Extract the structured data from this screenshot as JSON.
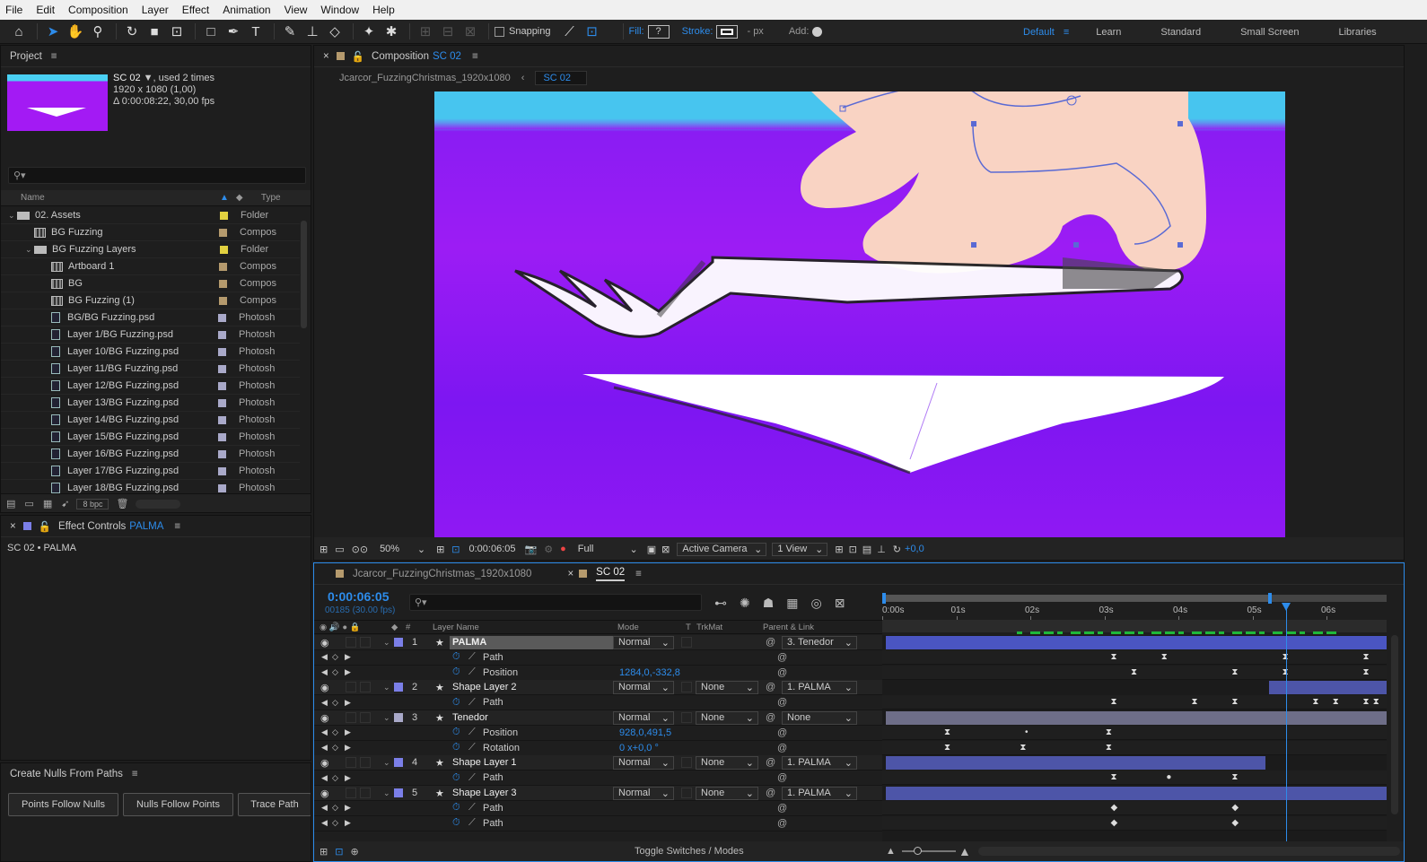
{
  "menu": [
    "File",
    "Edit",
    "Composition",
    "Layer",
    "Effect",
    "Animation",
    "View",
    "Window",
    "Help"
  ],
  "toolbar": {
    "snapping": "Snapping",
    "fill_label": "Fill:",
    "fill_value": "?",
    "stroke_label": "Stroke:",
    "stroke_unit": "- px",
    "add_label": "Add:",
    "workspaces": [
      "Default",
      "Learn",
      "Standard",
      "Small Screen",
      "Libraries"
    ]
  },
  "project": {
    "title": "Project",
    "comp_name": "SC 02",
    "used": ", used 2 times",
    "dims": "1920 x 1080 (1,00)",
    "duration": "Δ 0:00:08:22, 30,00 fps",
    "col_name": "Name",
    "col_type": "Type",
    "items": [
      {
        "name": "02. Assets",
        "type": "Folder",
        "indent": 0,
        "kind": "folder",
        "color": "#e2d140",
        "twirl": "open"
      },
      {
        "name": "BG Fuzzing",
        "type": "Compos",
        "indent": 1,
        "kind": "comp",
        "color": "#b59a6d",
        "twirl": ""
      },
      {
        "name": "BG Fuzzing Layers",
        "type": "Folder",
        "indent": 1,
        "kind": "folder",
        "color": "#e2d140",
        "twirl": "open"
      },
      {
        "name": "Artboard 1",
        "type": "Compos",
        "indent": 2,
        "kind": "comp",
        "color": "#b59a6d",
        "twirl": ""
      },
      {
        "name": "BG",
        "type": "Compos",
        "indent": 2,
        "kind": "comp",
        "color": "#b59a6d",
        "twirl": ""
      },
      {
        "name": "BG Fuzzing (1)",
        "type": "Compos",
        "indent": 2,
        "kind": "comp",
        "color": "#b59a6d",
        "twirl": ""
      },
      {
        "name": "BG/BG Fuzzing.psd",
        "type": "Photosh",
        "indent": 2,
        "kind": "psd",
        "color": "#a9a9c9",
        "twirl": ""
      },
      {
        "name": "Layer 1/BG Fuzzing.psd",
        "type": "Photosh",
        "indent": 2,
        "kind": "psd",
        "color": "#a9a9c9",
        "twirl": ""
      },
      {
        "name": "Layer 10/BG Fuzzing.psd",
        "type": "Photosh",
        "indent": 2,
        "kind": "psd",
        "color": "#a9a9c9",
        "twirl": ""
      },
      {
        "name": "Layer 11/BG Fuzzing.psd",
        "type": "Photosh",
        "indent": 2,
        "kind": "psd",
        "color": "#a9a9c9",
        "twirl": ""
      },
      {
        "name": "Layer 12/BG Fuzzing.psd",
        "type": "Photosh",
        "indent": 2,
        "kind": "psd",
        "color": "#a9a9c9",
        "twirl": ""
      },
      {
        "name": "Layer 13/BG Fuzzing.psd",
        "type": "Photosh",
        "indent": 2,
        "kind": "psd",
        "color": "#a9a9c9",
        "twirl": ""
      },
      {
        "name": "Layer 14/BG Fuzzing.psd",
        "type": "Photosh",
        "indent": 2,
        "kind": "psd",
        "color": "#a9a9c9",
        "twirl": ""
      },
      {
        "name": "Layer 15/BG Fuzzing.psd",
        "type": "Photosh",
        "indent": 2,
        "kind": "psd",
        "color": "#a9a9c9",
        "twirl": ""
      },
      {
        "name": "Layer 16/BG Fuzzing.psd",
        "type": "Photosh",
        "indent": 2,
        "kind": "psd",
        "color": "#a9a9c9",
        "twirl": ""
      },
      {
        "name": "Layer 17/BG Fuzzing.psd",
        "type": "Photosh",
        "indent": 2,
        "kind": "psd",
        "color": "#a9a9c9",
        "twirl": ""
      },
      {
        "name": "Layer 18/BG Fuzzing.psd",
        "type": "Photosh",
        "indent": 2,
        "kind": "psd",
        "color": "#a9a9c9",
        "twirl": ""
      }
    ],
    "bpc": "8 bpc"
  },
  "effect_controls": {
    "title": "Effect Controls",
    "layer": "PALMA",
    "crumb": "SC 02 • PALMA"
  },
  "nulls": {
    "title": "Create Nulls From Paths",
    "buttons": [
      "Points Follow Nulls",
      "Nulls Follow Points",
      "Trace Path"
    ]
  },
  "composition": {
    "title": "Composition",
    "name": "SC 02",
    "tabs": [
      "Jcarcor_FuzzingChristmas_1920x1080",
      "SC 02"
    ],
    "zoom": "50%",
    "timecode": "0:00:06:05",
    "resolution": "Full",
    "camera": "Active Camera",
    "views": "1 View",
    "exposure": "+0,0"
  },
  "timeline": {
    "tabs": [
      "Jcarcor_FuzzingChristmas_1920x1080",
      "SC 02"
    ],
    "timecode": "0:00:06:05",
    "frame_info": "00185 (30.00 fps)",
    "columns": {
      "num": "#",
      "layer": "Layer Name",
      "mode": "Mode",
      "t": "T",
      "trkmat": "TrkMat",
      "parent": "Parent & Link"
    },
    "ruler": [
      "0:00s",
      "01s",
      "02s",
      "03s",
      "04s",
      "05s",
      "06s"
    ],
    "playhead": 0.8,
    "rows": [
      {
        "type": "layer",
        "num": "1",
        "name": "PALMA",
        "mode": "Normal",
        "trk": "",
        "parent": "3. Tenedor",
        "color": "#7b7fe8",
        "selected": true,
        "bar": [
          0,
          1
        ],
        "barColor": "#4a55c2"
      },
      {
        "type": "prop",
        "name": "Path",
        "value": "",
        "keys": [
          0.46,
          0.56,
          0.8,
          0.96
        ],
        "kshape": "hg"
      },
      {
        "type": "prop",
        "name": "Position",
        "value": "1284,0,-332,8",
        "keys": [
          0.5,
          0.7,
          0.8,
          0.96
        ],
        "kshape": "hg"
      },
      {
        "type": "layer",
        "num": "2",
        "name": "Shape Layer 2",
        "mode": "Normal",
        "trk": "None",
        "parent": "1. PALMA",
        "color": "#7b7fe8",
        "selected": false,
        "bar": [
          0.76,
          1
        ],
        "barColor": "#4d55a8"
      },
      {
        "type": "prop",
        "name": "Path",
        "value": "",
        "keys": [
          0.46,
          0.62,
          0.7,
          0.86,
          0.9,
          0.96,
          0.98
        ],
        "kshape": "hg"
      },
      {
        "type": "layer",
        "num": "3",
        "name": "Tenedor",
        "mode": "Normal",
        "trk": "None",
        "parent": "None",
        "color": "#a9a9c9",
        "selected": false,
        "bar": [
          0,
          1
        ],
        "barColor": "#6e6e88"
      },
      {
        "type": "prop",
        "name": "Position",
        "value": "928,0,491,5",
        "keys": [
          0.13,
          0.29,
          0.45
        ],
        "kshape": "mixed"
      },
      {
        "type": "prop",
        "name": "Rotation",
        "value": "0 x+0,0 °",
        "keys": [
          0.13,
          0.28,
          0.45
        ],
        "kshape": "hg"
      },
      {
        "type": "layer",
        "num": "4",
        "name": "Shape Layer 1",
        "mode": "Normal",
        "trk": "None",
        "parent": "1. PALMA",
        "color": "#7b7fe8",
        "selected": false,
        "bar": [
          0,
          0.76
        ],
        "barColor": "#4d55a8"
      },
      {
        "type": "prop",
        "name": "Path",
        "value": "",
        "keys": [
          0.46,
          0.57,
          0.7
        ],
        "kshape": "mixed2"
      },
      {
        "type": "layer",
        "num": "5",
        "name": "Shape Layer 3",
        "mode": "Normal",
        "trk": "None",
        "parent": "1. PALMA",
        "color": "#7b7fe8",
        "selected": false,
        "bar": [
          0,
          1
        ],
        "barColor": "#4d55a8"
      },
      {
        "type": "prop",
        "name": "Path",
        "value": "",
        "keys": [
          0.46,
          0.7
        ],
        "kshape": "diamond"
      },
      {
        "type": "prop",
        "name": "Path",
        "value": "",
        "keys": [
          0.46,
          0.7
        ],
        "kshape": "diamond"
      }
    ],
    "footer": "Toggle Switches / Modes"
  }
}
